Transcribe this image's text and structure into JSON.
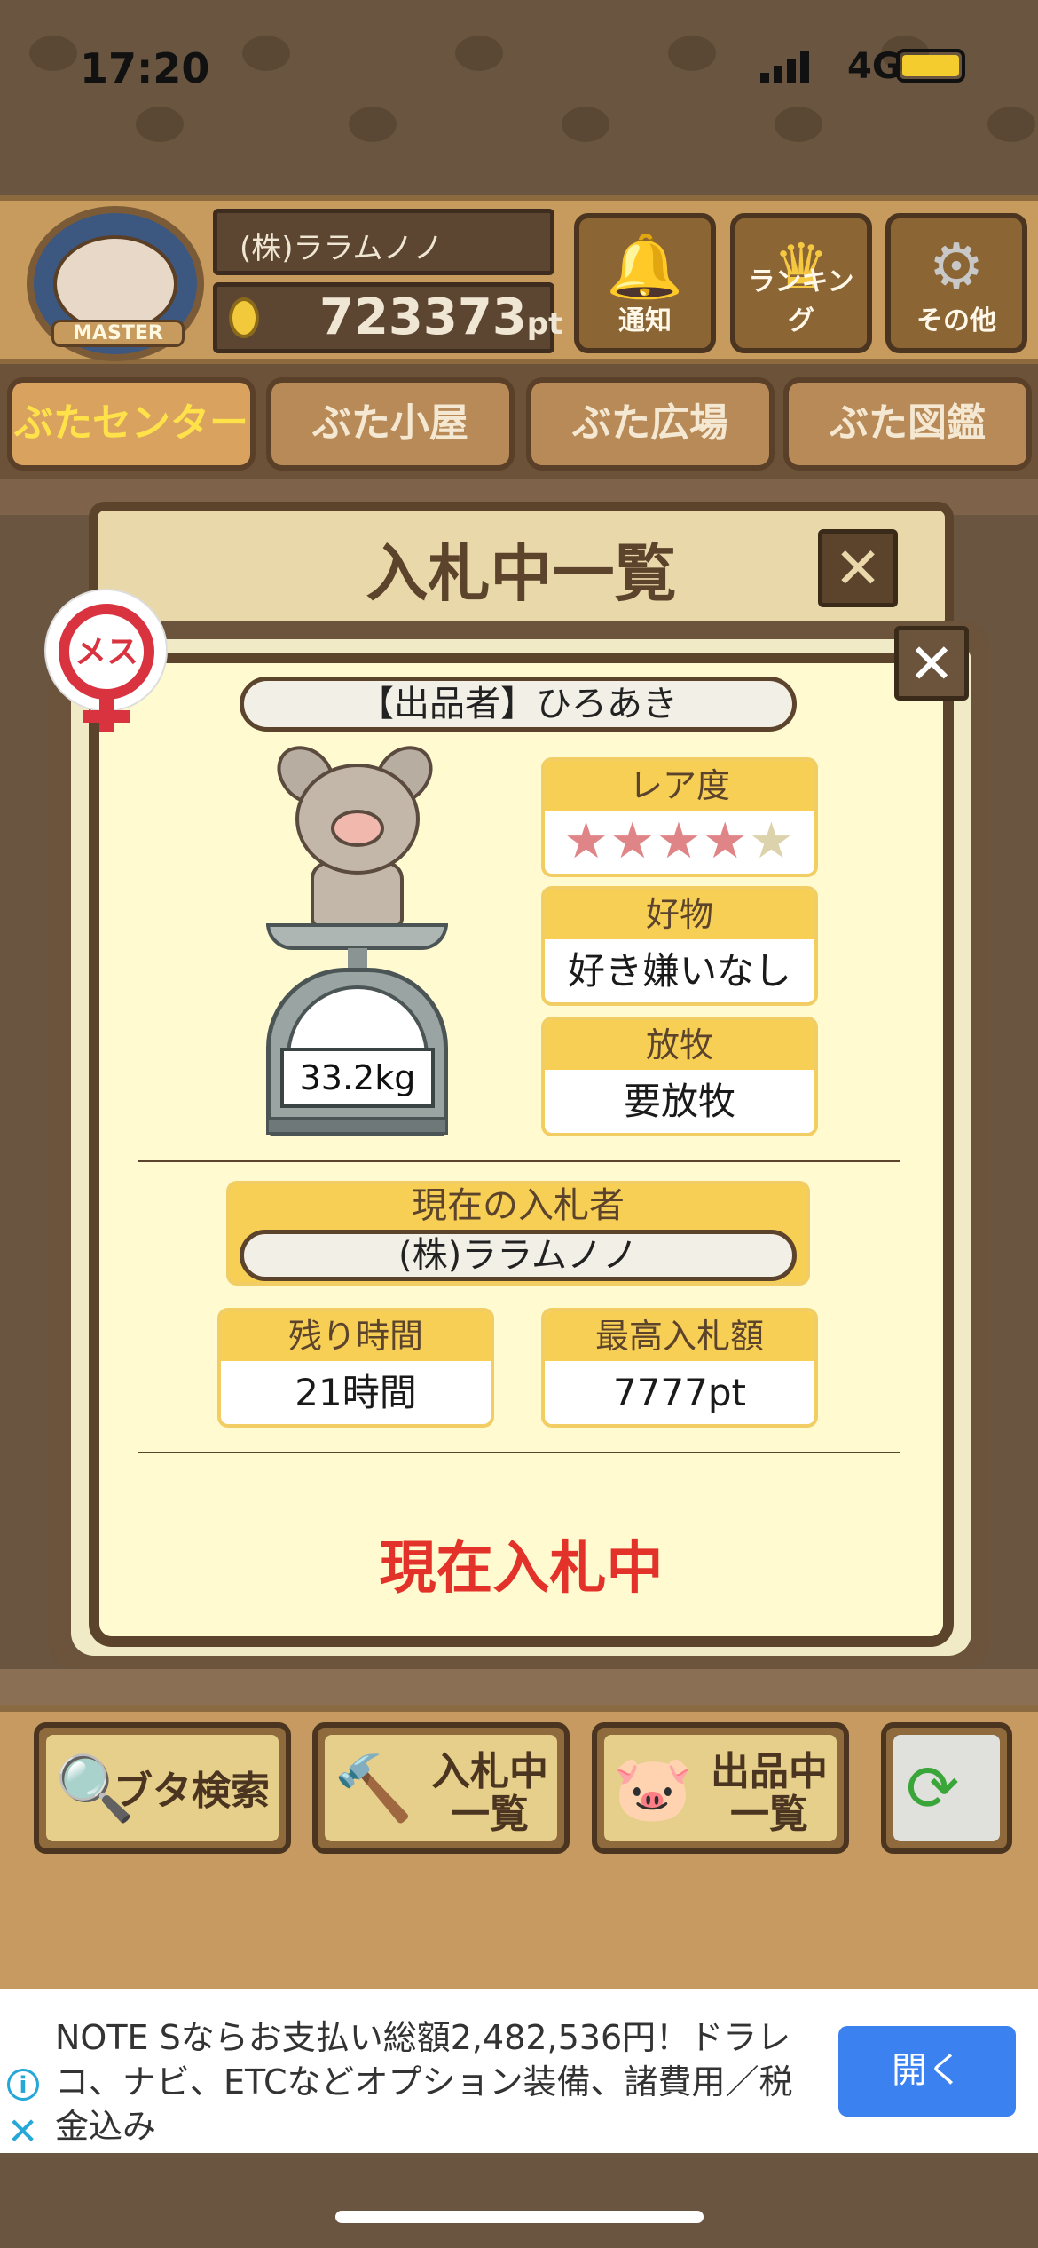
{
  "status_bar": {
    "time": "17:20",
    "network": "4G"
  },
  "header": {
    "badge_label": "MASTER",
    "player_name": "(株)ララムノノ",
    "points": "723373",
    "points_unit": "pt",
    "buttons": [
      {
        "label": "通知",
        "icon": "bell-icon"
      },
      {
        "label": "ランキング",
        "icon": "crown-icon"
      },
      {
        "label": "その他",
        "icon": "gear-icon"
      }
    ]
  },
  "tabs": [
    {
      "label": "ぶたセンター",
      "active": true
    },
    {
      "label": "ぶた小屋",
      "active": false
    },
    {
      "label": "ぶた広場",
      "active": false
    },
    {
      "label": "ぶた図鑑",
      "active": false
    }
  ],
  "panel": {
    "title": "入札中一覧",
    "close_glyph": "✕"
  },
  "detail": {
    "gender": "メス",
    "seller": "【出品者】ひろあき",
    "weight": "33.2kg",
    "rarity_label": "レア度",
    "rarity_value": 4,
    "rarity_max": 5,
    "favorite_label": "好物",
    "favorite_value": "好き嫌いなし",
    "grazing_label": "放牧",
    "grazing_value": "要放牧",
    "bidder_label": "現在の入札者",
    "bidder_value": "(株)ララムノノ",
    "time_left_label": "残り時間",
    "time_left_value": "21時間",
    "top_bid_label": "最高入札額",
    "top_bid_value": "7777pt",
    "status": "現在入札中"
  },
  "toolbar": {
    "search": "ブタ検索",
    "bidding_line1": "入札中",
    "bidding_line2": "一覧",
    "listing_line1": "出品中",
    "listing_line2": "一覧"
  },
  "ad": {
    "text": "NOTE Sならお支払い総額2,482,536円！ドラレコ、ナビ、ETCなどオプション装備、諸費用／税金込み",
    "open_label": "開く"
  },
  "colors": {
    "accent_red": "#e2322a",
    "wood": "#c69a60",
    "ad_button": "#3b82f0"
  }
}
